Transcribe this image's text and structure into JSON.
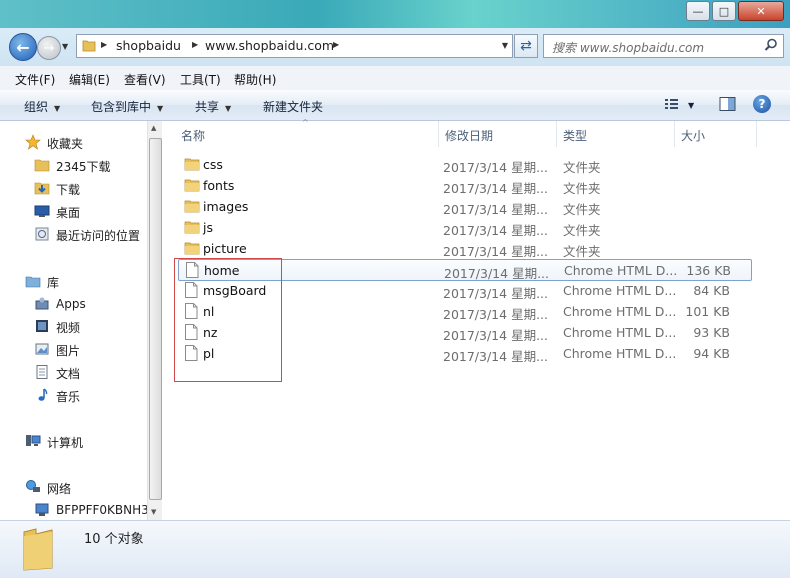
{
  "window": {
    "controls": {
      "minimize": "—",
      "maximize": "□",
      "close": "✕"
    }
  },
  "address": {
    "crumbs": [
      "shopbaidu",
      "www.shopbaidu.com"
    ],
    "search_placeholder": "搜索 www.shopbaidu.com"
  },
  "menu": [
    "文件(F)",
    "编辑(E)",
    "查看(V)",
    "工具(T)",
    "帮助(H)"
  ],
  "commands": {
    "organize": "组织",
    "include_in_library": "包含到库中",
    "share": "共享",
    "new_folder": "新建文件夹"
  },
  "nav": {
    "favorites": "收藏夹",
    "fav_items": [
      "2345下载",
      "下载",
      "桌面",
      "最近访问的位置"
    ],
    "libraries": "库",
    "lib_items": [
      "Apps",
      "视频",
      "图片",
      "文档",
      "音乐"
    ],
    "computer": "计算机",
    "network": "网络",
    "net_items": [
      "BFPPFF0KBNH3"
    ]
  },
  "columns": {
    "name": "名称",
    "date": "修改日期",
    "type": "类型",
    "size": "大小"
  },
  "files": [
    {
      "name": "css",
      "date": "2017/3/14 星期...",
      "type": "文件夹",
      "size": "",
      "kind": "folder"
    },
    {
      "name": "fonts",
      "date": "2017/3/14 星期...",
      "type": "文件夹",
      "size": "",
      "kind": "folder"
    },
    {
      "name": "images",
      "date": "2017/3/14 星期...",
      "type": "文件夹",
      "size": "",
      "kind": "folder"
    },
    {
      "name": "js",
      "date": "2017/3/14 星期...",
      "type": "文件夹",
      "size": "",
      "kind": "folder"
    },
    {
      "name": "picture",
      "date": "2017/3/14 星期...",
      "type": "文件夹",
      "size": "",
      "kind": "folder"
    },
    {
      "name": "home",
      "date": "2017/3/14 星期...",
      "type": "Chrome HTML D...",
      "size": "136 KB",
      "kind": "file"
    },
    {
      "name": "msgBoard",
      "date": "2017/3/14 星期...",
      "type": "Chrome HTML D...",
      "size": "84 KB",
      "kind": "file"
    },
    {
      "name": "nl",
      "date": "2017/3/14 星期...",
      "type": "Chrome HTML D...",
      "size": "101 KB",
      "kind": "file"
    },
    {
      "name": "nz",
      "date": "2017/3/14 星期...",
      "type": "Chrome HTML D...",
      "size": "93 KB",
      "kind": "file"
    },
    {
      "name": "pl",
      "date": "2017/3/14 星期...",
      "type": "Chrome HTML D...",
      "size": "94 KB",
      "kind": "file"
    }
  ],
  "status": {
    "count_text": "10 个对象"
  },
  "colors": {
    "highlight_border": "#7da2ce",
    "annotation_box": "#d14a4a"
  }
}
